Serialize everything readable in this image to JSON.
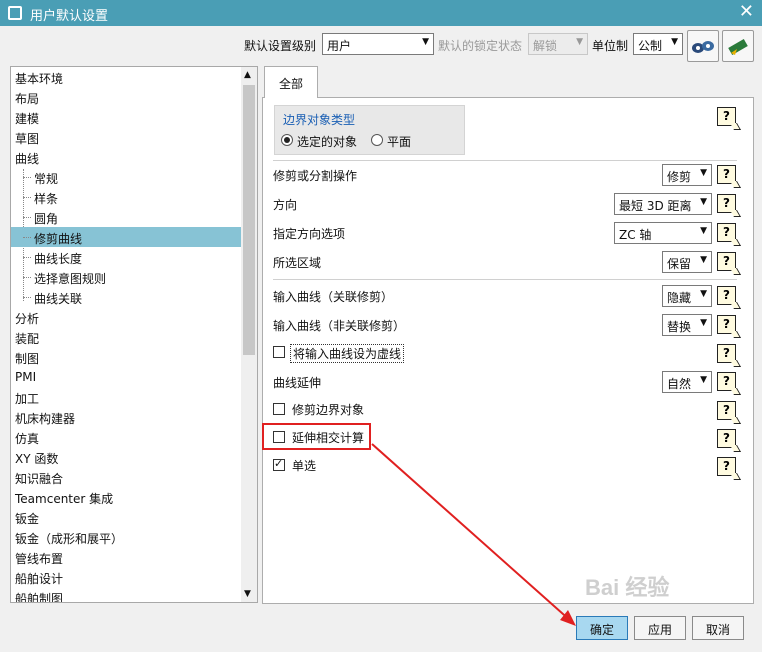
{
  "window": {
    "title": "用户默认设置",
    "close_label": "✕"
  },
  "toolbar": {
    "level_label": "默认设置级别",
    "level_value": "用户",
    "lock_label": "默认的锁定状态",
    "lock_value": "解锁",
    "unit_label": "单位制",
    "unit_value": "公制",
    "icon1": "manage-icon",
    "icon2": "migrate-icon"
  },
  "tree": {
    "items": [
      "基本环境",
      "布局",
      "建模",
      "草图",
      "曲线",
      "常规",
      "样条",
      "圆角",
      "修剪曲线",
      "曲线长度",
      "选择意图规则",
      "曲线关联",
      "分析",
      "装配",
      "制图",
      "PMI",
      "加工",
      "机床构建器",
      "仿真",
      "XY 函数",
      "知识融合",
      "Teamcenter 集成",
      "钣金",
      "钣金（成形和展平）",
      "管线布置",
      "船舶设计",
      "船舶制图"
    ],
    "selected": "修剪曲线"
  },
  "tab": {
    "label": "全部"
  },
  "boundary": {
    "title": "边界对象类型",
    "option1": "选定的对象",
    "option2": "平面",
    "selected": "选定的对象"
  },
  "settings": {
    "trim_op_label": "修剪或分割操作",
    "trim_op_value": "修剪",
    "direction_label": "方向",
    "direction_value": "最短 3D 距离",
    "dir_option_label": "指定方向选项",
    "dir_option_value": "ZC 轴",
    "region_label": "所选区域",
    "region_value": "保留",
    "input_assoc_label": "输入曲线（关联修剪）",
    "input_assoc_value": "隐藏",
    "input_nonassoc_label": "输入曲线（非关联修剪）",
    "input_nonassoc_value": "替换",
    "dashed_label": "将输入曲线设为虚线",
    "dashed_checked": false,
    "extension_label": "曲线延伸",
    "extension_value": "自然",
    "trim_boundary_label": "修剪边界对象",
    "trim_boundary_checked": false,
    "extend_intersection_label": "延伸相交计算",
    "extend_intersection_checked": false,
    "single_label": "单选",
    "single_checked": true,
    "help_symbol": "?"
  },
  "buttons": {
    "ok": "确定",
    "apply": "应用",
    "cancel": "取消"
  },
  "annotation_color": "#e02020",
  "watermark": "Bai 经验"
}
